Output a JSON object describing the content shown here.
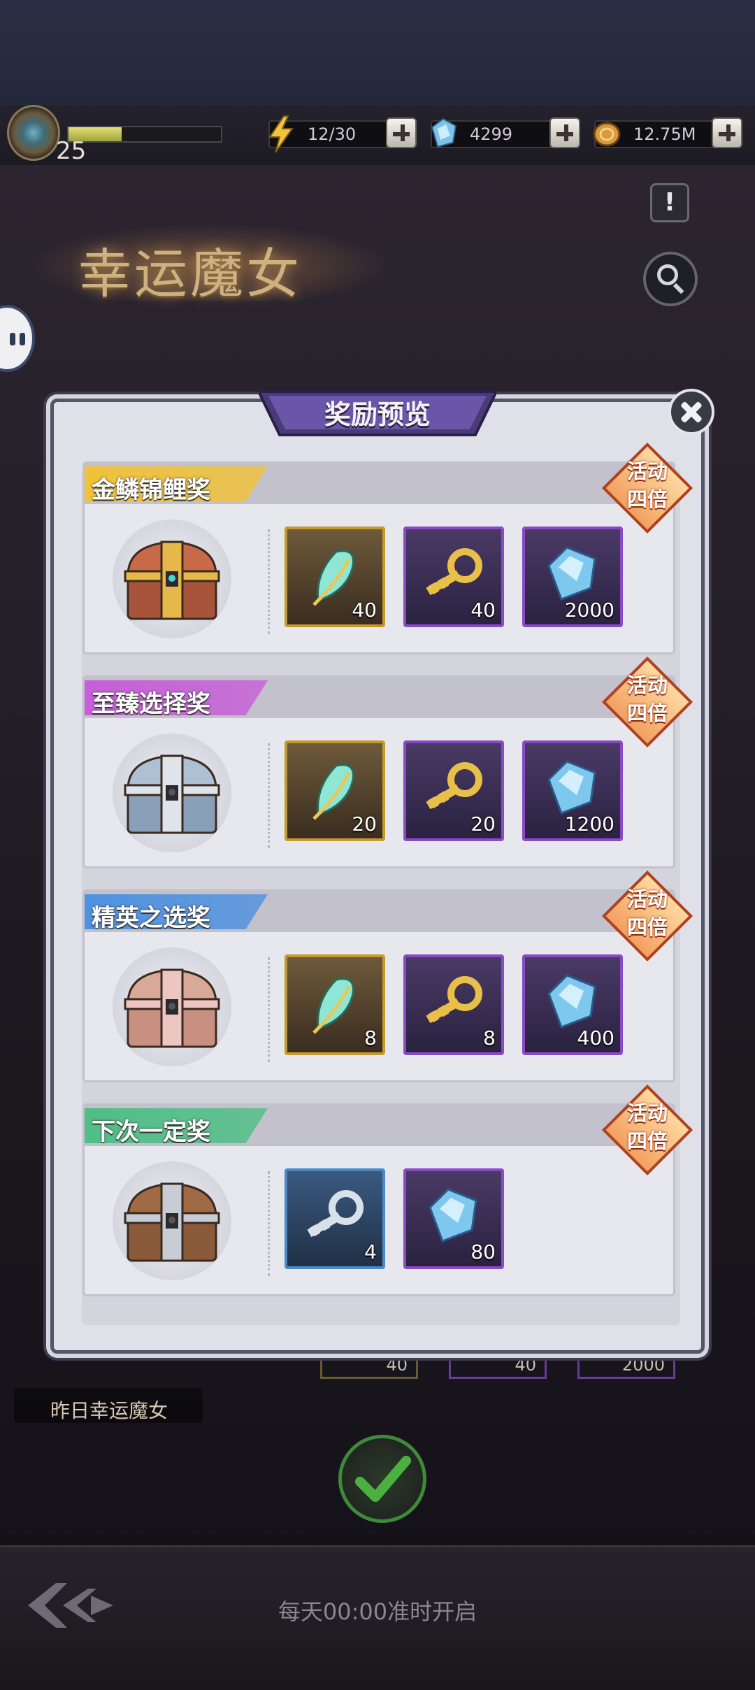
{
  "hud": {
    "level": "25",
    "xp_fraction": 0.35,
    "stamina": "12/30",
    "gems": "4299",
    "gold": "12.75M",
    "icons": [
      "level-emblem-icon",
      "lightning-icon",
      "crystal-icon",
      "coin-icon",
      "plus-icon"
    ]
  },
  "page": {
    "title": "幸运魔女",
    "yesterday_label": "昨日幸运魔女",
    "daily_notice": "每天00:00准时开启",
    "peek_values": [
      "40",
      "40",
      "2000"
    ]
  },
  "modal": {
    "title": "奖励预览",
    "badge_text": [
      "活动",
      "四倍"
    ],
    "tiers": [
      {
        "name": "金鳞锦鲤奖",
        "tab_color": "#f0c23a",
        "chest": "gold-chest",
        "items": [
          {
            "type": "feather",
            "frame": "gold",
            "qty": "40"
          },
          {
            "type": "gold-key",
            "frame": "purple",
            "qty": "40"
          },
          {
            "type": "diamond",
            "frame": "purple",
            "qty": "2000"
          }
        ]
      },
      {
        "name": "至臻选择奖",
        "tab_color": "#c65fd8",
        "chest": "silver-chest",
        "items": [
          {
            "type": "feather",
            "frame": "gold",
            "qty": "20"
          },
          {
            "type": "gold-key",
            "frame": "purple",
            "qty": "20"
          },
          {
            "type": "diamond",
            "frame": "purple",
            "qty": "1200"
          }
        ]
      },
      {
        "name": "精英之选奖",
        "tab_color": "#4f92e0",
        "chest": "pink-chest",
        "items": [
          {
            "type": "feather",
            "frame": "gold",
            "qty": "8"
          },
          {
            "type": "gold-key",
            "frame": "purple",
            "qty": "8"
          },
          {
            "type": "diamond",
            "frame": "purple",
            "qty": "400"
          }
        ]
      },
      {
        "name": "下次一定奖",
        "tab_color": "#4fbf86",
        "chest": "wood-chest",
        "items": [
          {
            "type": "silver-key",
            "frame": "blue",
            "qty": "4"
          },
          {
            "type": "diamond",
            "frame": "purple",
            "qty": "80"
          }
        ]
      }
    ]
  }
}
